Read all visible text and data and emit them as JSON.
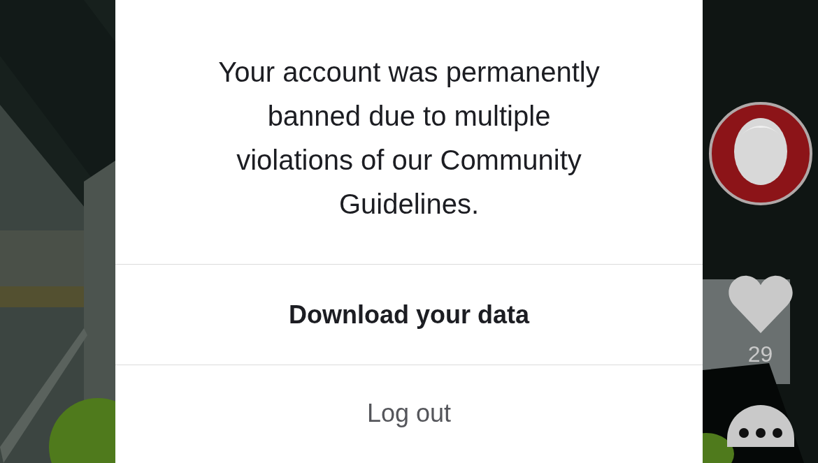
{
  "dialog": {
    "message": "Your account was permanently banned due to multiple violations of our Community Guidelines.",
    "buttons": [
      {
        "label": "Download your data",
        "kind": "primary"
      },
      {
        "label": "Log out",
        "kind": "secondary"
      }
    ]
  },
  "side_rail": {
    "like_count": "29"
  }
}
